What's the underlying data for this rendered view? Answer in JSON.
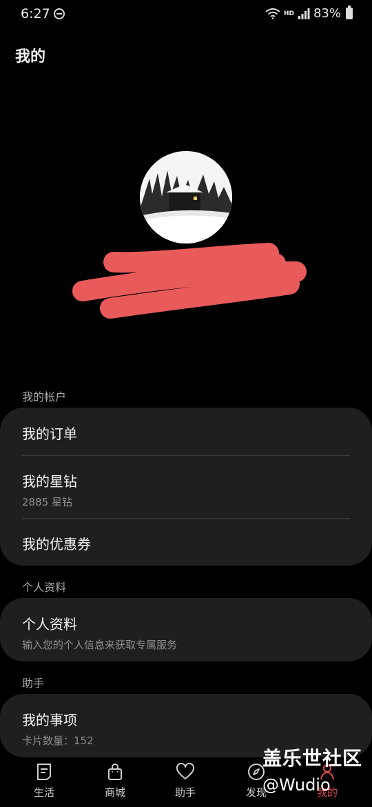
{
  "status_bar": {
    "time": "6:27",
    "battery": "83%",
    "network_label": "HD",
    "icons": [
      "do-not-disturb-icon",
      "wifi-icon",
      "signal-icon",
      "battery-icon"
    ]
  },
  "header": {
    "title": "我的"
  },
  "profile": {
    "avatar_icon": "cabin-in-forest-avatar",
    "redaction_color": "#e95a5a"
  },
  "sections": [
    {
      "label": "我的帐户",
      "rows": [
        {
          "title": "我的订单"
        },
        {
          "title": "我的星钻",
          "subtitle": "2885 星钻"
        },
        {
          "title": "我的优惠券"
        }
      ]
    },
    {
      "label": "个人资料",
      "rows": [
        {
          "title": "个人资料",
          "subtitle": "输入您的个人信息来获取专属服务"
        }
      ]
    },
    {
      "label": "助手",
      "rows": [
        {
          "title": "我的事项",
          "subtitle": "卡片数量：152"
        }
      ]
    }
  ],
  "tabs": [
    {
      "label": "生活",
      "icon": "life-card-icon"
    },
    {
      "label": "商城",
      "icon": "shopping-bag-icon"
    },
    {
      "label": "助手",
      "icon": "heart-icon"
    },
    {
      "label": "发现",
      "icon": "compass-icon"
    },
    {
      "label": "我的",
      "icon": "person-icon",
      "active": true
    }
  ],
  "watermark": {
    "brand": "盖乐世社区",
    "handle": "@Wudio"
  },
  "colors": {
    "background": "#000000",
    "card": "#1f1f1f",
    "active_tab": "#e04848"
  }
}
